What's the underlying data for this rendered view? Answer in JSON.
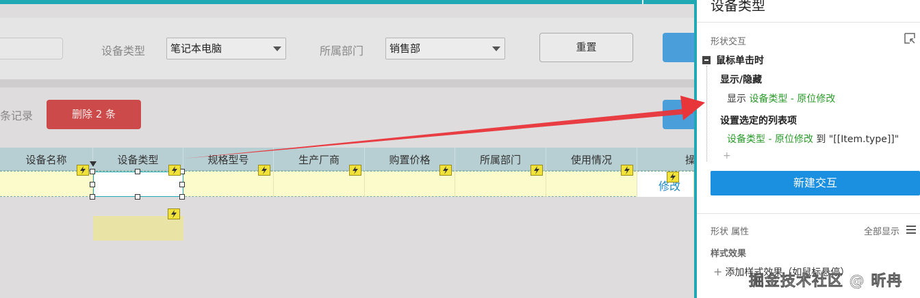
{
  "filters": {
    "device_type_label": "设备类型",
    "device_type_value": "笔记本电脑",
    "department_label": "所属部门",
    "department_value": "销售部",
    "reset_label": "重置"
  },
  "actions": {
    "record_text": "条记录",
    "delete_label": "删除 2 条"
  },
  "table": {
    "columns": [
      "设备名称",
      "设备类型",
      "规格型号",
      "生产厂商",
      "购置价格",
      "所属部门",
      "使用情况",
      "操"
    ],
    "row_action": "修改"
  },
  "panel": {
    "title": "设备类型",
    "section_interaction": "形状交互",
    "event": "鼠标单击时",
    "action1_title": "显示/隐藏",
    "action1_verb": "显示",
    "action1_target": "设备类型 - 原位修改",
    "action2_title": "设置选定的列表项",
    "action2_target": "设备类型 - 原位修改",
    "action2_to": "到",
    "action2_value": "\"[[Item.type]]\"",
    "add_plus": "+",
    "new_interaction": "新建交互",
    "section_props": "形状 属性",
    "show_all": "全部显示",
    "style_effects": "样式效果",
    "add_style": "添加样式效果（如鼠标悬停）"
  },
  "watermark": "掘金技术社区 @ 昕冉",
  "colors": {
    "accent_teal": "#20a8b4",
    "delete_red": "#cd4a4a",
    "primary_blue": "#1b8fe0",
    "header_teal": "#b7ced2",
    "row_yellow": "#fbfbcb",
    "action_green": "#2a9a2a",
    "arrow_red": "#e8353a"
  },
  "icons": {
    "interaction": "lightning-bolt-icon",
    "collapse": "minus-square-icon",
    "dropdown": "chevron-down-icon",
    "expand": "expand-corner-icon",
    "menu": "hamburger-menu-icon"
  }
}
